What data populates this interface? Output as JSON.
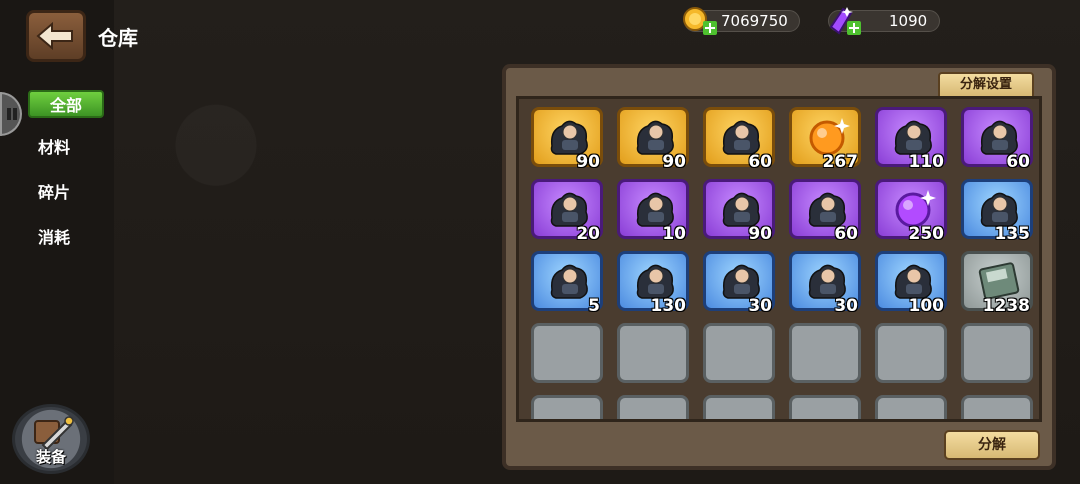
{
  "header": {
    "title": "仓库"
  },
  "currencies": [
    {
      "icon": "gold-coin-icon",
      "value": "7069750"
    },
    {
      "icon": "purple-crystal-icon",
      "value": "1090"
    }
  ],
  "categories": [
    {
      "label": "全部",
      "active": true
    },
    {
      "label": "材料",
      "active": false
    },
    {
      "label": "碎片",
      "active": false
    },
    {
      "label": "消耗",
      "active": false
    }
  ],
  "equip": {
    "label": "装备"
  },
  "panel": {
    "settings_label": "分解设置",
    "decompose_label": "分解"
  },
  "items": [
    {
      "rarity": "gold",
      "icon": "hero-fragment-icon",
      "qty": "90"
    },
    {
      "rarity": "gold",
      "icon": "hero-fragment-icon",
      "qty": "90"
    },
    {
      "rarity": "gold",
      "icon": "hero-fragment-icon",
      "qty": "60"
    },
    {
      "rarity": "gold",
      "icon": "orange-gem-icon",
      "qty": "267"
    },
    {
      "rarity": "purple",
      "icon": "hero-fragment-icon",
      "qty": "110"
    },
    {
      "rarity": "purple",
      "icon": "hero-fragment-icon",
      "qty": "60"
    },
    {
      "rarity": "purple",
      "icon": "hero-fragment-icon",
      "qty": "20"
    },
    {
      "rarity": "purple",
      "icon": "hero-fragment-icon",
      "qty": "10"
    },
    {
      "rarity": "purple",
      "icon": "hero-fragment-icon",
      "qty": "90"
    },
    {
      "rarity": "purple",
      "icon": "hero-fragment-icon",
      "qty": "60"
    },
    {
      "rarity": "purple",
      "icon": "purple-gem-icon",
      "qty": "250"
    },
    {
      "rarity": "blue",
      "icon": "hero-fragment-icon",
      "qty": "135"
    },
    {
      "rarity": "blue",
      "icon": "hero-fragment-icon",
      "qty": "5"
    },
    {
      "rarity": "blue",
      "icon": "hero-fragment-icon",
      "qty": "130"
    },
    {
      "rarity": "blue",
      "icon": "hero-fragment-icon",
      "qty": "30"
    },
    {
      "rarity": "blue",
      "icon": "hero-fragment-icon",
      "qty": "30"
    },
    {
      "rarity": "blue",
      "icon": "hero-fragment-icon",
      "qty": "100"
    },
    {
      "rarity": "grey",
      "icon": "exp-book-icon",
      "qty": "1238"
    }
  ],
  "empty_slots": 12
}
